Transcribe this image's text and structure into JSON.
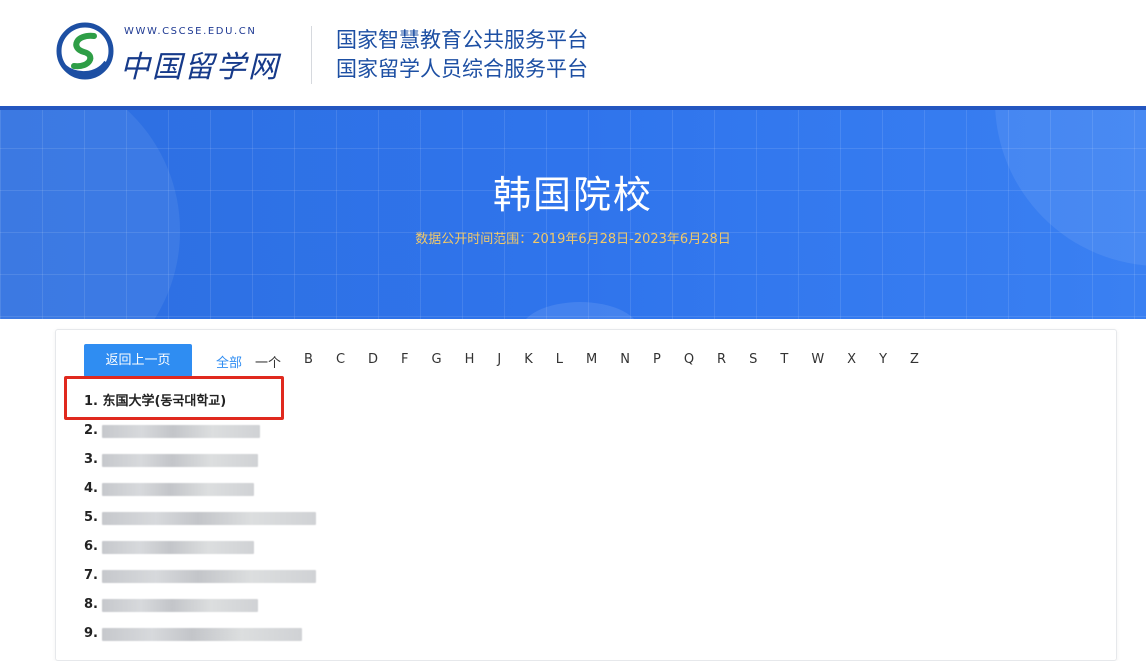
{
  "header": {
    "logo_url": "WWW.CSCSE.EDU.CN",
    "logo_name": "中国留学网",
    "platform_line1": "国家智慧教育公共服务平台",
    "platform_line2": "国家留学人员综合服务平台"
  },
  "banner": {
    "title": "韩国院校",
    "subtitle": "数据公开时间范围：2019年6月28日-2023年6月28日"
  },
  "filter": {
    "back_label": "返回上一页",
    "all_label": "全部",
    "letters": [
      "一个",
      "B",
      "C",
      "D",
      "F",
      "G",
      "H",
      "J",
      "K",
      "L",
      "M",
      "N",
      "P",
      "Q",
      "R",
      "S",
      "T",
      "W",
      "X",
      "Y",
      "Z"
    ]
  },
  "list": {
    "items": [
      {
        "num": "1.",
        "name": "东国大学(동국대학교)"
      },
      {
        "num": "2.",
        "name": ""
      },
      {
        "num": "3.",
        "name": ""
      },
      {
        "num": "4.",
        "name": ""
      },
      {
        "num": "5.",
        "name": ""
      },
      {
        "num": "6.",
        "name": ""
      },
      {
        "num": "7.",
        "name": ""
      },
      {
        "num": "8.",
        "name": ""
      },
      {
        "num": "9.",
        "name": ""
      }
    ]
  },
  "colors": {
    "brand_blue": "#2f74ec",
    "accent_button": "#2f8df2",
    "subtitle_gold": "#f1c96a",
    "highlight_red": "#e0291e"
  }
}
